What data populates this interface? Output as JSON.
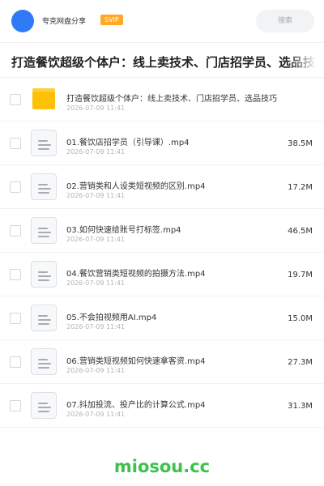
{
  "header": {
    "share_name": "夸克网盘分享",
    "badge": "SVIP",
    "search_label": "搜索"
  },
  "title": "打造餐饮超级个体户：线上卖技术、门店招学员、选品技巧",
  "folder": {
    "name": "打造餐饮超级个体户：线上卖技术、门店招学员、选品技巧",
    "date": "2026-07-09 11:41",
    "icon": "folder-icon"
  },
  "files": [
    {
      "name": "01.餐饮店招学员（引导课）.mp4",
      "date": "2026-07-09 11:41",
      "size": "38.5M",
      "icon": "video-file-icon"
    },
    {
      "name": "02.营销类和人设类短视频的区别.mp4",
      "date": "2026-07-09 11:41",
      "size": "17.2M",
      "icon": "video-file-icon"
    },
    {
      "name": "03.如何快速给账号打标签.mp4",
      "date": "2026-07-09 11:41",
      "size": "46.5M",
      "icon": "video-file-icon"
    },
    {
      "name": "04.餐饮营销类短视频的拍摄方法.mp4",
      "date": "2026-07-09 11:41",
      "size": "19.7M",
      "icon": "video-file-icon"
    },
    {
      "name": "05.不会拍视频用AI.mp4",
      "date": "2026-07-09 11:41",
      "size": "15.0M",
      "icon": "video-file-icon"
    },
    {
      "name": "06.营销类短视频如何快速拿客资.mp4",
      "date": "2026-07-09 11:41",
      "size": "27.3M",
      "icon": "video-file-icon"
    },
    {
      "name": "07.抖加投流、投产比的计算公式.mp4",
      "date": "2026-07-09 11:41",
      "size": "31.3M",
      "icon": "video-file-icon"
    }
  ],
  "watermark": "miosou.cc",
  "colors": {
    "avatar": "#2f7bf6",
    "badge": "#ffa726",
    "folder": "#ffc107",
    "watermark": "#3cc24a"
  }
}
